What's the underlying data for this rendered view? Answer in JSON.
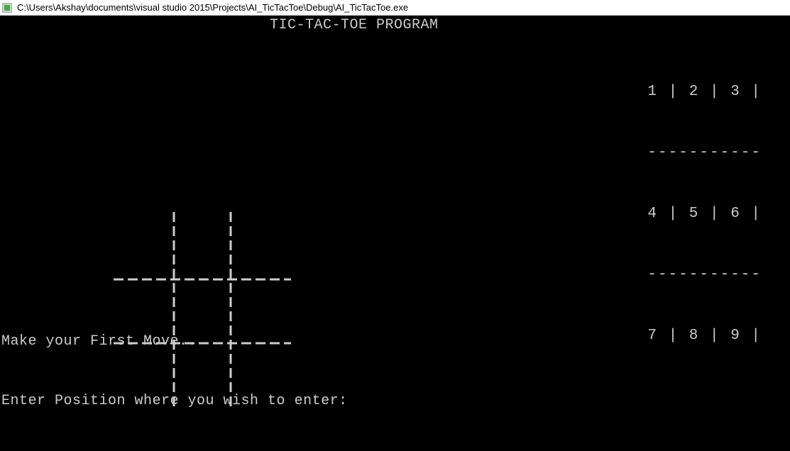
{
  "window": {
    "title": "C:\\Users\\Akshay\\documents\\visual studio 2015\\Projects\\AI_TicTacToe\\Debug\\AI_TicTacToe.exe"
  },
  "console": {
    "heading": "TIC-TAC-TOE PROGRAM",
    "legend": {
      "row1": "1 | 2 | 3 |",
      "sep": "-----------",
      "row2": "4 | 5 | 6 |",
      "row3": "7 | 8 | 9 |"
    },
    "prompt_line1": "Make your First Move..",
    "prompt_line2": "Enter Position where you wish to enter:"
  }
}
